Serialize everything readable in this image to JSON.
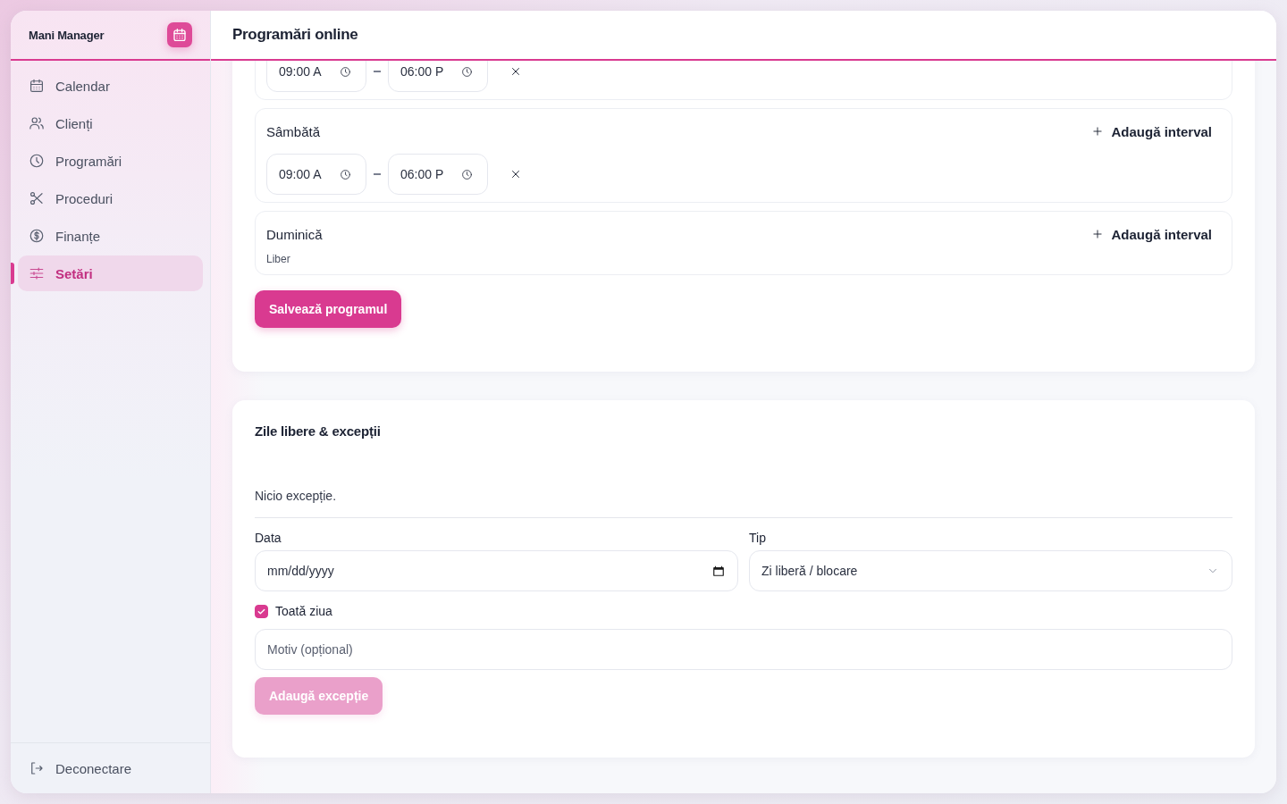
{
  "sidebar": {
    "brand": "Mani Manager",
    "items": [
      {
        "label": "Calendar",
        "selected": false
      },
      {
        "label": "Clienți",
        "selected": false
      },
      {
        "label": "Programări",
        "selected": false
      },
      {
        "label": "Proceduri",
        "selected": false
      },
      {
        "label": "Finanțe",
        "selected": false
      },
      {
        "label": "Setări",
        "selected": true
      }
    ],
    "logout": "Deconectare"
  },
  "header": {
    "title": "Programări online"
  },
  "schedule": {
    "days": [
      {
        "intervals": [
          {
            "start": "09:00 A",
            "end": "06:00 P"
          }
        ]
      },
      {
        "name": "Sâmbătă",
        "add_label": "Adaugă interval",
        "intervals": [
          {
            "start": "09:00 A",
            "end": "06:00 P"
          }
        ]
      },
      {
        "name": "Duminică",
        "add_label": "Adaugă interval",
        "off_label": "Liber"
      }
    ],
    "save_button": "Salvează programul"
  },
  "exceptions": {
    "title": "Zile libere & excepții",
    "empty_text": "Nicio excepție.",
    "date": {
      "label": "Data",
      "placeholder": "mm/dd/yyyy"
    },
    "type": {
      "label": "Tip",
      "value": "Zi liberă / blocare"
    },
    "all_day": {
      "label": "Toată ziua",
      "checked": true
    },
    "reason": {
      "placeholder": "Motiv (opțional)"
    },
    "add_button": {
      "label": "Adaugă excepție",
      "disabled": true
    }
  }
}
